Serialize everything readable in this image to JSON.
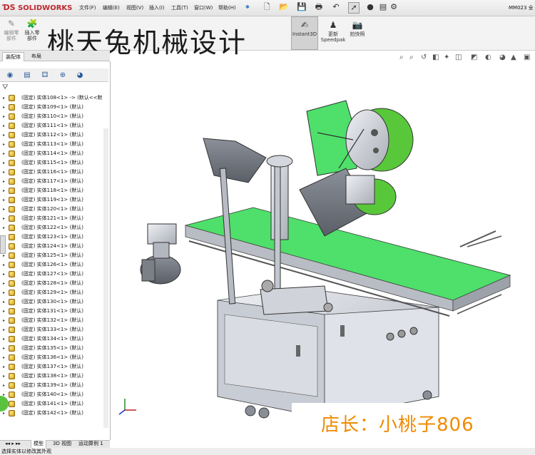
{
  "app": {
    "logo": "SOLIDWORKS",
    "filename": "MM023 全"
  },
  "menubar": {
    "items": [
      "文件(F)",
      "编辑(E)",
      "视图(V)",
      "插入(I)",
      "工具(T)",
      "窗口(W)",
      "帮助(H)"
    ],
    "pin": "✱"
  },
  "ribbon": {
    "edit_component": "编辑零部件",
    "insert_component": "插入零部件",
    "instant3d": "Instant3D",
    "update_speedpak": "更新 Speedpak",
    "snapshot": "拍快照"
  },
  "watermark": "桃天兔机械设计",
  "cmd_tabs": [
    "装配体",
    "布局"
  ],
  "tree": {
    "first_row": "(固定) 实体108<1> -> (默认<<默",
    "rows": [
      "(固定) 实体109<1> (默认)",
      "(固定) 实体110<1> (默认)",
      "(固定) 实体111<1> (默认)",
      "(固定) 实体112<1> (默认)",
      "(固定) 实体113<1> (默认)",
      "(固定) 实体114<1> (默认)",
      "(固定) 实体115<1> (默认)",
      "(固定) 实体116<1> (默认)",
      "(固定) 实体117<1> (默认)",
      "(固定) 实体118<1> (默认)",
      "(固定) 实体119<1> (默认)",
      "(固定) 实体120<1> (默认)",
      "(固定) 实体121<1> (默认)",
      "(固定) 实体122<1> (默认)",
      "(固定) 实体123<1> (默认)",
      "(固定) 实体124<1> (默认)",
      "(固定) 实体125<1> (默认)",
      "(固定) 实体126<1> (默认)",
      "(固定) 实体127<1> (默认)",
      "(固定) 实体128<1> (默认)",
      "(固定) 实体129<1> (默认)",
      "(固定) 实体130<1> (默认)",
      "(固定) 实体131<1> (默认)",
      "(固定) 实体132<1> (默认)",
      "(固定) 实体133<1> (默认)",
      "(固定) 实体134<1> (默认)",
      "(固定) 实体135<1> (默认)",
      "(固定) 实体136<1> (默认)",
      "(固定) 实体137<1> (默认)",
      "(固定) 实体138<1> (默认)",
      "(固定) 实体139<1> (默认)",
      "(固定) 实体140<1> (默认)",
      "(固定) 实体141<1> (默认)",
      "(固定) 实体142<1> (默认)"
    ]
  },
  "bottom_tabs": [
    "模型",
    "3D 视图",
    "运动算例 1"
  ],
  "status": "选择实体以修改其外观",
  "shop_label": "店长：小桃子806",
  "colors": {
    "belt": "#4ee06a",
    "roll": "#58c83a",
    "brand": "#c0282d",
    "shop_text": "#f08a00"
  }
}
